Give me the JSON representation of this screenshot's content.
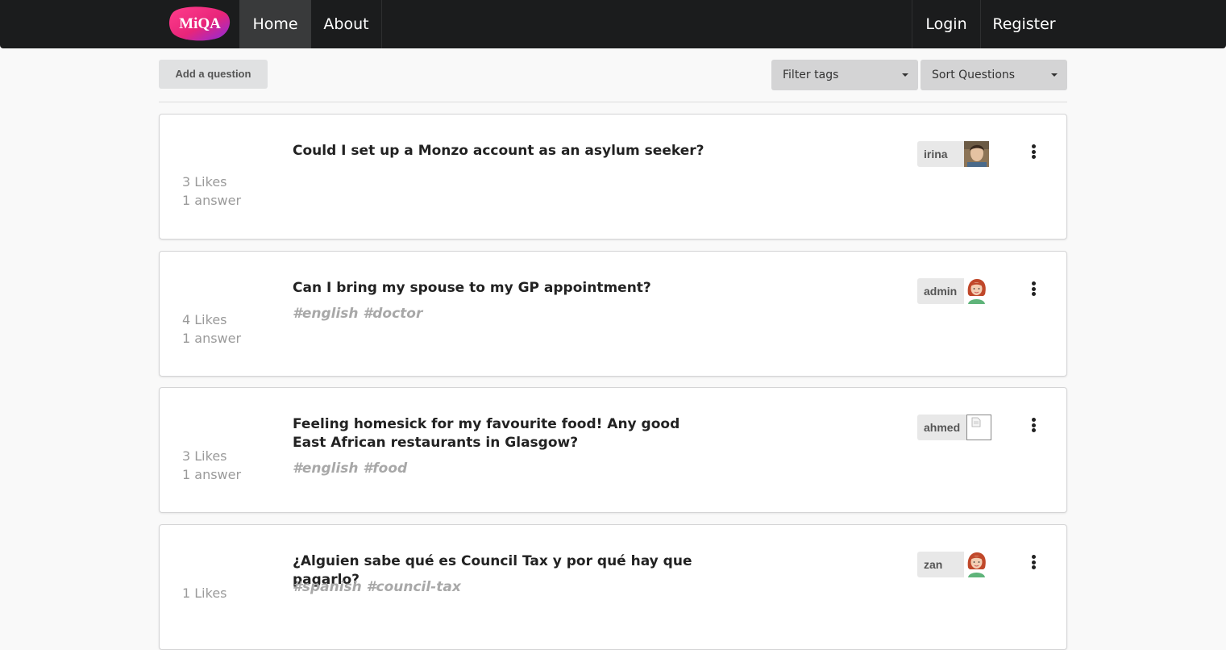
{
  "nav": {
    "logo_text": "MiQA",
    "home": "Home",
    "about": "About",
    "login": "Login",
    "register": "Register"
  },
  "toolbar": {
    "add_question": "Add a question",
    "filter_tags": "Filter tags",
    "sort_questions": "Sort Questions"
  },
  "questions": [
    {
      "likes": "3 Likes",
      "answers": "1 answer",
      "title": "Could I set up a Monzo account as an asylum seeker?",
      "tags": "",
      "user": "irina",
      "avatar": "photo-avatar-icon"
    },
    {
      "likes": "4 Likes",
      "answers": "1 answer",
      "title": "Can I bring my spouse to my GP appointment?",
      "tags": "#english #doctor",
      "user": "admin",
      "avatar": "woman-avatar-icon"
    },
    {
      "likes": "3 Likes",
      "answers": "1 answer",
      "title": "Feeling homesick for my favourite food! Any good East African restaurants in Glasgow?",
      "tags": "#english #food",
      "user": "ahmed",
      "avatar": "broken-image-icon"
    },
    {
      "likes": "1 Likes",
      "answers": "",
      "title": "¿Alguien sabe qué es Council Tax y por qué hay que pagarlo?",
      "tags": "#spanish #council-tax",
      "user": "zan",
      "avatar": "woman-avatar-icon"
    }
  ]
}
